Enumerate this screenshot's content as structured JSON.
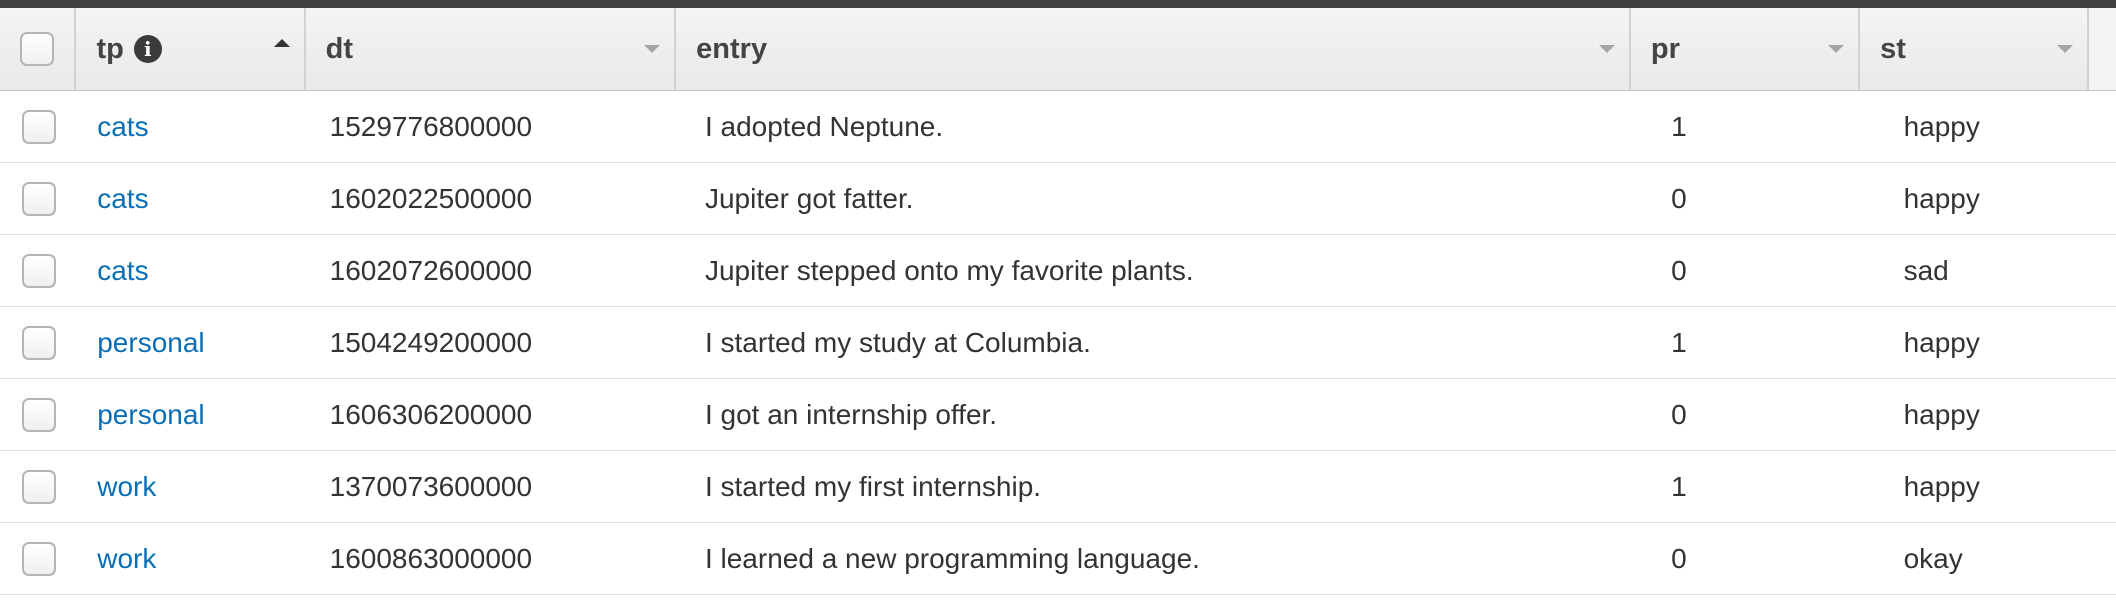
{
  "table": {
    "columns": [
      {
        "key": "tp",
        "label": "tp",
        "sort": "ascending",
        "has_info_icon": true
      },
      {
        "key": "dt",
        "label": "dt",
        "sort": "none"
      },
      {
        "key": "entry",
        "label": "entry",
        "sort": "none"
      },
      {
        "key": "pr",
        "label": "pr",
        "sort": "none"
      },
      {
        "key": "st",
        "label": "st",
        "sort": "none"
      }
    ],
    "info_icon_glyph": "i",
    "rows": [
      {
        "tp": "cats",
        "dt": "1529776800000",
        "entry": "I adopted Neptune.",
        "pr": "1",
        "st": "happy"
      },
      {
        "tp": "cats",
        "dt": "1602022500000",
        "entry": "Jupiter got fatter.",
        "pr": "0",
        "st": "happy"
      },
      {
        "tp": "cats",
        "dt": "1602072600000",
        "entry": "Jupiter stepped onto my favorite plants.",
        "pr": "0",
        "st": "sad"
      },
      {
        "tp": "personal",
        "dt": "1504249200000",
        "entry": "I started my study at Columbia.",
        "pr": "1",
        "st": "happy"
      },
      {
        "tp": "personal",
        "dt": "1606306200000",
        "entry": "I got an internship offer.",
        "pr": "0",
        "st": "happy"
      },
      {
        "tp": "work",
        "dt": "1370073600000",
        "entry": "I started my first internship.",
        "pr": "1",
        "st": "happy"
      },
      {
        "tp": "work",
        "dt": "1600863000000",
        "entry": "I learned a new programming language.",
        "pr": "0",
        "st": "okay"
      }
    ]
  },
  "colors": {
    "link": "#0a6eb4",
    "header_bg": "#ececec",
    "top_bar": "#3f3f3f"
  }
}
